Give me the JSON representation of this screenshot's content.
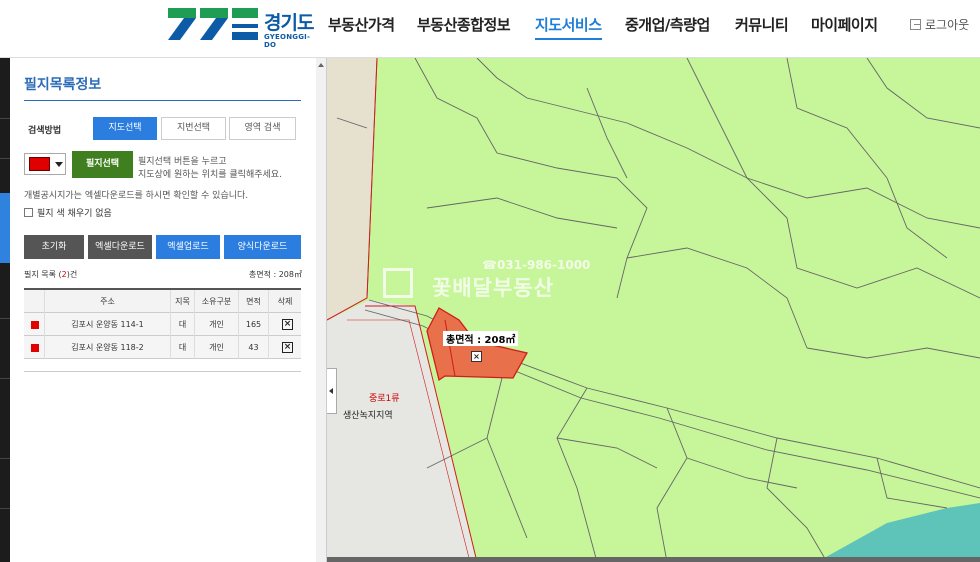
{
  "header": {
    "logo": {
      "ko": "경기도",
      "en": "GYEONGGI-DO"
    },
    "nav": [
      "부동산가격",
      "부동산종합정보",
      "지도서비스",
      "중개업/측량업",
      "커뮤니티",
      "마이페이지"
    ],
    "active_nav": "지도서비스",
    "logout_label": "로그아웃",
    "colors": {
      "brand_blue": "#0d5aa7",
      "brand_green": "#1f9d55",
      "active_nav": "#1f7fd6"
    }
  },
  "panel": {
    "title": "필지목록정보",
    "search_method_label": "검색방법",
    "tabs": [
      "지도선택",
      "지번선택",
      "영역 검색"
    ],
    "active_tab": "지도선택",
    "color_value": "#e00000",
    "select_button": "필지선택",
    "help_line1": "필지선택 버튼을 누르고",
    "help_line2": "지도상에 원하는 위치를 클릭해주세요.",
    "notice": "개별공시지가는 엑셀다운로드를 하시면 확인할 수 있습니다.",
    "fill_checkbox": "필지 색 채우기 없음",
    "buttons": [
      "초기화",
      "엑셀다운로드",
      "엑셀업로드",
      "양식다운로드"
    ],
    "count_prefix": "필지 목록 (",
    "count_value": "2",
    "count_suffix": ")건",
    "total_area": "총면적 : 208㎡",
    "table": {
      "headers": [
        "",
        "주소",
        "지목",
        "소유구분",
        "면적",
        "삭제"
      ],
      "rows": [
        {
          "address": "김포시 운양동 114-1",
          "category": "대",
          "owner": "개인",
          "area": "165"
        },
        {
          "address": "김포시 운양동 118-2",
          "category": "대",
          "owner": "개인",
          "area": "43"
        }
      ]
    }
  },
  "map": {
    "road_label": "중로1류",
    "zone_label": "생산녹지지역",
    "area_popup": "총면적 : 208㎡",
    "watermark_phone": "☎031-986-1000",
    "watermark_name": "꽃배달부동산",
    "colors": {
      "land": "#c7f59a",
      "parcel": "#e8704a",
      "road": "#e6e6e2",
      "water": "#5ec3b8"
    }
  }
}
